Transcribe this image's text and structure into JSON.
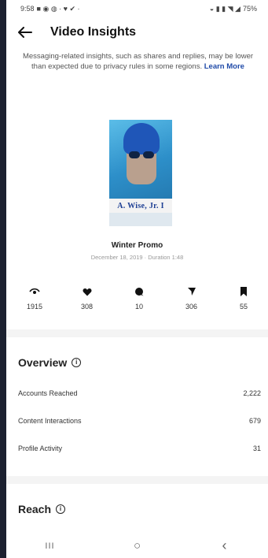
{
  "status_bar": {
    "time": "9:58",
    "battery": "75%"
  },
  "header": {
    "title": "Video Insights"
  },
  "notice": {
    "text": "Messaging-related insights, such as shares and replies, may be lower than expected due to privacy rules in some regions.",
    "link": "Learn More"
  },
  "media": {
    "thumbnail_text": "A. Wise, Jr. I",
    "title": "Winter Promo",
    "subtitle": "December 18, 2019 · Duration 1:48"
  },
  "stats": [
    {
      "icon": "eye-icon",
      "value": "1915"
    },
    {
      "icon": "heart-icon",
      "value": "308"
    },
    {
      "icon": "comment-icon",
      "value": "10"
    },
    {
      "icon": "share-icon",
      "value": "306"
    },
    {
      "icon": "bookmark-icon",
      "value": "55"
    }
  ],
  "overview": {
    "title": "Overview",
    "rows": [
      {
        "label": "Accounts Reached",
        "value": "2,222"
      },
      {
        "label": "Content Interactions",
        "value": "679"
      },
      {
        "label": "Profile Activity",
        "value": "31"
      }
    ]
  },
  "reach": {
    "title": "Reach"
  },
  "nav": {
    "recents": "III",
    "home": "○",
    "back": "‹"
  },
  "colors": {
    "link": "#1f4aa8",
    "background": "#ffffff",
    "divider": "#f4f4f4"
  }
}
